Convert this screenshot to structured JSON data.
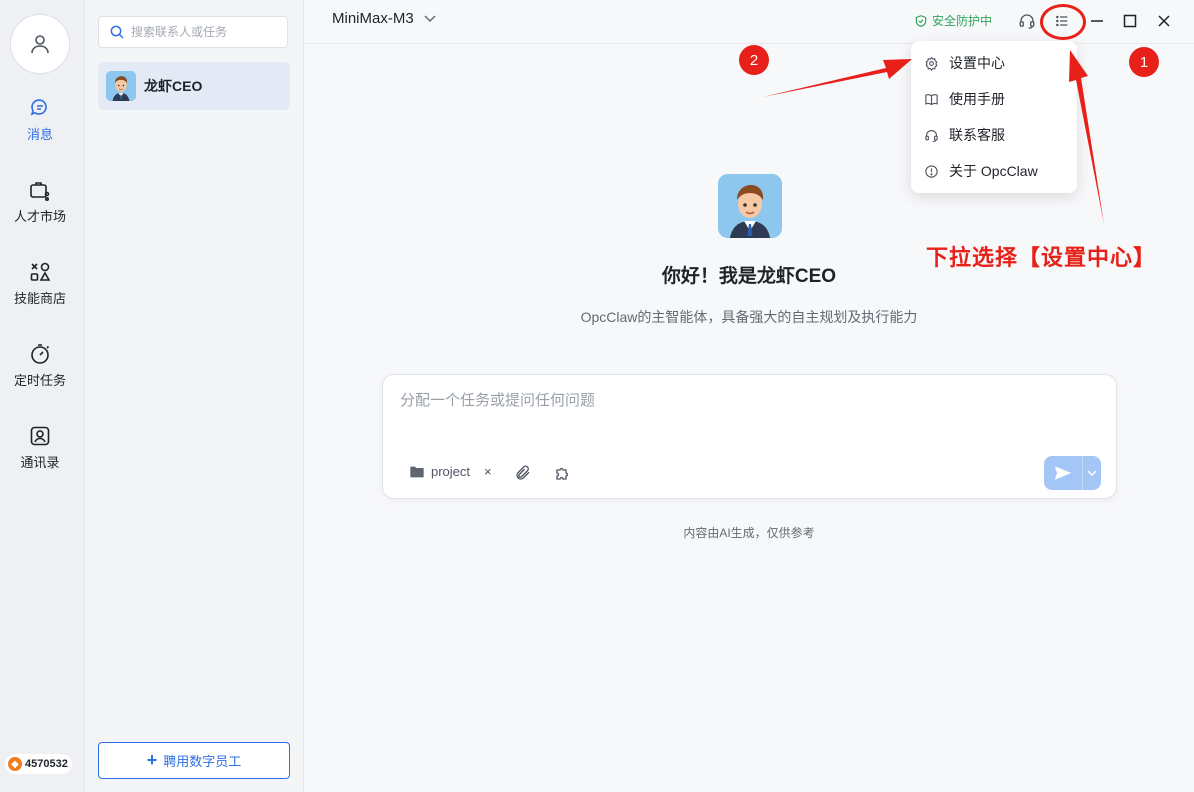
{
  "nav": {
    "items": [
      {
        "label": "消息",
        "icon": "chat-bubble-icon"
      },
      {
        "label": "人才市场",
        "icon": "briefcase-share-icon"
      },
      {
        "label": "技能商店",
        "icon": "shapes-icon"
      },
      {
        "label": "定时任务",
        "icon": "stopwatch-icon"
      },
      {
        "label": "通讯录",
        "icon": "contact-card-icon"
      }
    ],
    "points": "4570532"
  },
  "contacts": {
    "search_placeholder": "搜索联系人或任务",
    "items": [
      {
        "name": "龙虾CEO"
      }
    ],
    "hire_label": "聘用数字员工"
  },
  "topbar": {
    "model": "MiniMax-M3",
    "security": "安全防护中"
  },
  "dropdown": {
    "items": [
      {
        "label": "设置中心",
        "icon": "gear-icon"
      },
      {
        "label": "使用手册",
        "icon": "book-icon"
      },
      {
        "label": "联系客服",
        "icon": "headset-icon"
      },
      {
        "label": "关于 OpcClaw",
        "icon": "info-icon"
      }
    ]
  },
  "main": {
    "greeting": "你好！我是龙虾CEO",
    "subtitle": "OpcClaw的主智能体，具备强大的自主规划及执行能力",
    "composer_placeholder": "分配一个任务或提问任何问题",
    "folder_chip": "project",
    "chip_close": "×",
    "disclaimer": "内容由AI生成，仅供参考"
  },
  "annotation": {
    "badge_1": "1",
    "badge_2": "2",
    "text": "下拉选择【设置中心】"
  },
  "colors": {
    "accent": "#2f6fe4",
    "annotation_red": "#e8201a",
    "safe_green": "#2ea55a"
  }
}
